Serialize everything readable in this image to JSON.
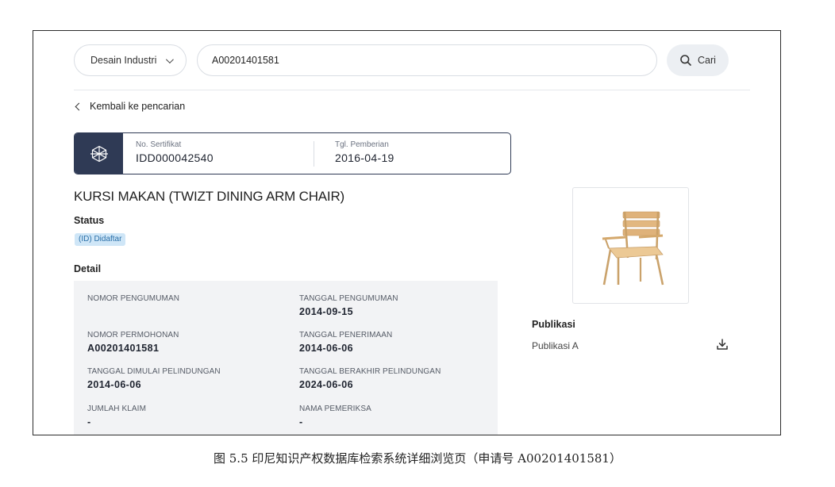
{
  "search": {
    "type_value": "Desain Industri",
    "query_value": "A00201401581",
    "button_label": "Cari"
  },
  "back_link": "Kembali ke pencarian",
  "certificate": {
    "no_label": "No. Sertifikat",
    "no_value": "IDD000042540",
    "date_label": "Tgl. Pemberian",
    "date_value": "2016-04-19"
  },
  "title": "KURSI MAKAN (TWIZT DINING ARM CHAIR)",
  "status": {
    "label": "Status",
    "badge": "(ID) Didaftar"
  },
  "detail": {
    "label": "Detail",
    "items": [
      {
        "key": "NOMOR PENGUMUMAN",
        "value": ""
      },
      {
        "key": "TANGGAL PENGUMUMAN",
        "value": "2014-09-15"
      },
      {
        "key": "NOMOR PERMOHONAN",
        "value": "A00201401581"
      },
      {
        "key": "TANGGAL PENERIMAAN",
        "value": "2014-06-06"
      },
      {
        "key": "TANGGAL DIMULAI PELINDUNGAN",
        "value": "2014-06-06"
      },
      {
        "key": "TANGGAL BERAKHIR PELINDUNGAN",
        "value": "2024-06-06"
      },
      {
        "key": "JUMLAH KLAIM",
        "value": "-"
      },
      {
        "key": "NAMA PEMERIKSA",
        "value": "-"
      }
    ]
  },
  "publication": {
    "label": "Publikasi",
    "items": [
      {
        "name": "Publikasi A"
      }
    ]
  },
  "icons": {
    "search": "search-icon",
    "chevron": "chevron-down-icon",
    "back": "chevron-left-icon",
    "certificate": "cube-icon",
    "download": "download-icon"
  },
  "colors": {
    "card_accent": "#2f3a55",
    "badge_bg": "#cfe6f7",
    "badge_text": "#2a6fa8",
    "panel_bg": "#f2f3f5"
  },
  "caption": "图 5.5  印尼知识产权数据库检索系统详细浏览页（申请号 A00201401581）"
}
